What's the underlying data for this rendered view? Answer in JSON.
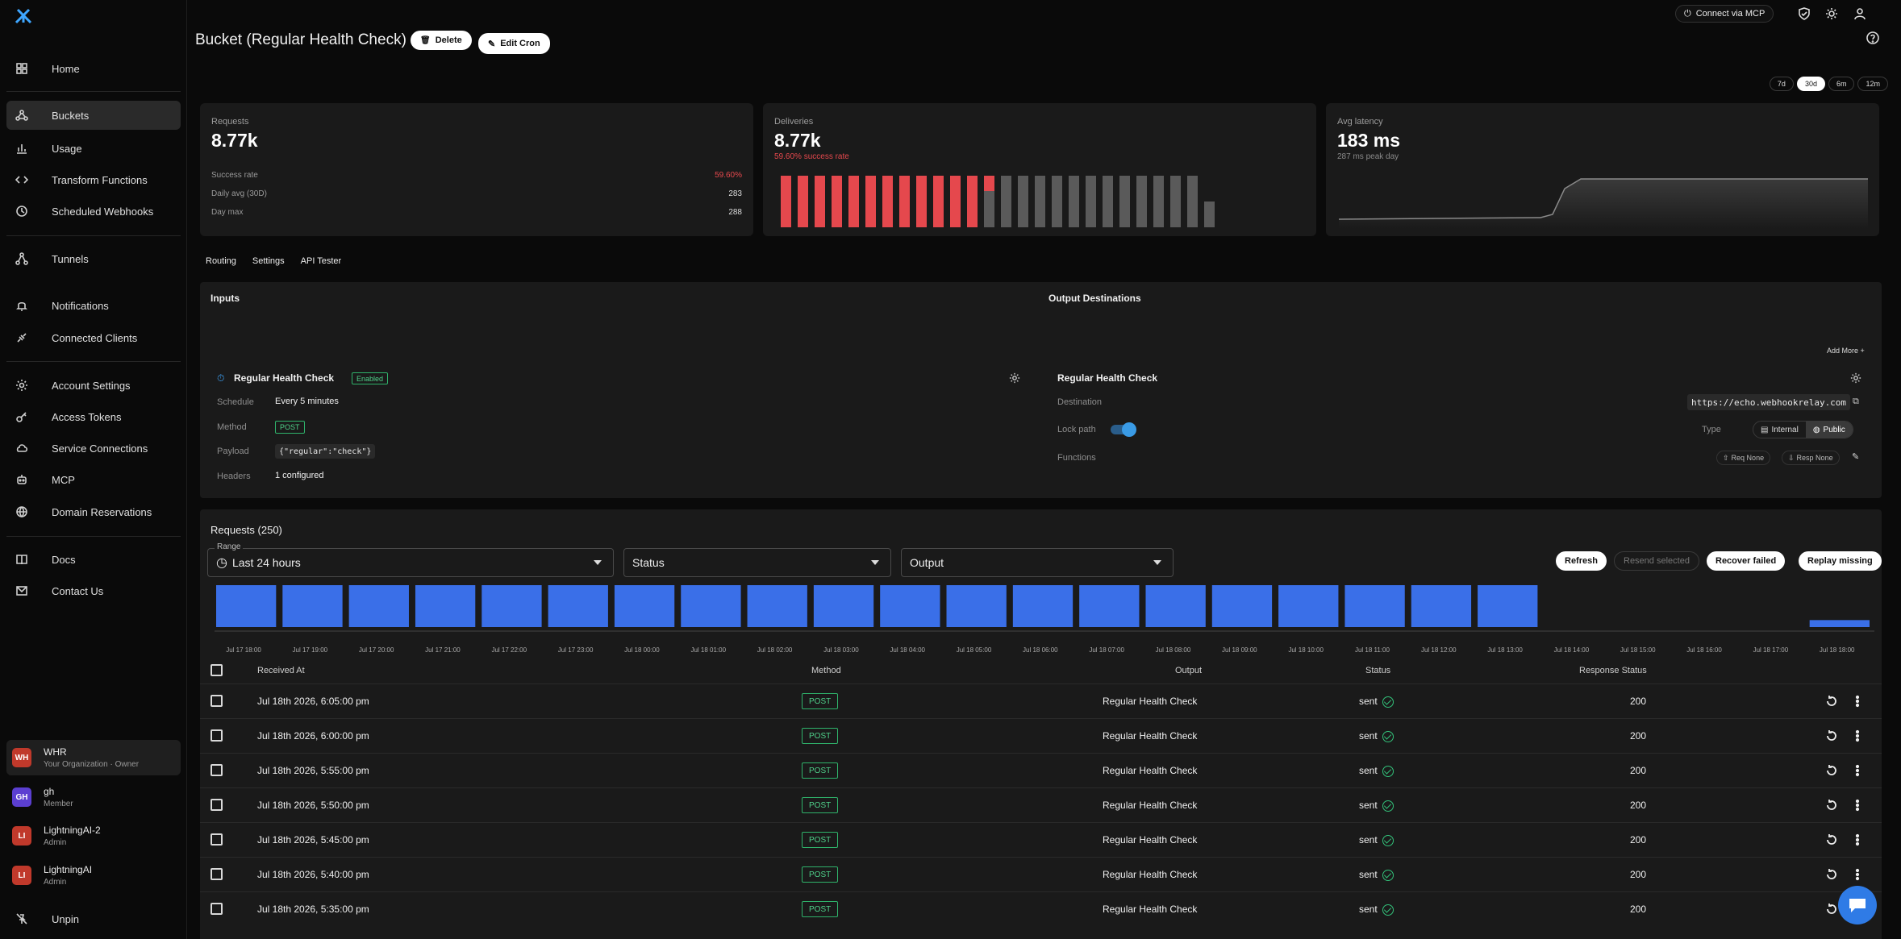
{
  "nav": {
    "items": [
      {
        "label": "Home",
        "icon": "grid-icon"
      },
      {
        "label": "Buckets",
        "icon": "webhook-icon"
      },
      {
        "label": "Usage",
        "icon": "bar-chart-icon"
      },
      {
        "label": "Transform Functions",
        "icon": "code-icon"
      },
      {
        "label": "Scheduled Webhooks",
        "icon": "clock-icon"
      },
      {
        "label": "Tunnels",
        "icon": "tunnel-icon"
      },
      {
        "label": "Notifications",
        "icon": "bell-icon"
      },
      {
        "label": "Connected Clients",
        "icon": "plug-icon"
      },
      {
        "label": "Account Settings",
        "icon": "gear-icon"
      },
      {
        "label": "Access Tokens",
        "icon": "key-icon"
      },
      {
        "label": "Service Connections",
        "icon": "cloud-icon"
      },
      {
        "label": "MCP",
        "icon": "robot-icon"
      },
      {
        "label": "Domain Reservations",
        "icon": "globe-icon"
      },
      {
        "label": "Docs",
        "icon": "book-icon"
      },
      {
        "label": "Contact Us",
        "icon": "mail-icon"
      }
    ],
    "active": "Buckets",
    "orgs": [
      {
        "initials": "WH",
        "name": "WHR",
        "role": "Your Organization · Owner",
        "color": "#c0392b"
      },
      {
        "initials": "GH",
        "name": "gh",
        "role": "Member",
        "color": "#5b3fd1"
      },
      {
        "initials": "LI",
        "name": "LightningAI-2",
        "role": "Admin",
        "color": "#c0392b"
      },
      {
        "initials": "LI",
        "name": "LightningAI",
        "role": "Admin",
        "color": "#c0392b"
      }
    ],
    "unpin": "Unpin"
  },
  "topbar": {
    "connect_mcp": "Connect via MCP"
  },
  "header": {
    "title": "Bucket (Regular Health Check)",
    "delete": "Delete",
    "edit_cron": "Edit Cron"
  },
  "ranges": [
    "7d",
    "30d",
    "6m",
    "12m"
  ],
  "selected_range": "30d",
  "cards": {
    "requests": {
      "label": "Requests",
      "value": "8.77k",
      "success_label": "Success rate",
      "success_value": "59.60%",
      "daily_label": "Daily avg (30D)",
      "daily_value": "283",
      "max_label": "Day max",
      "max_value": "288"
    },
    "deliveries": {
      "label": "Deliveries",
      "value": "8.77k",
      "sub": "59.60% success rate",
      "bars": {
        "red_full": 12,
        "split": 1,
        "grey": 13
      }
    },
    "latency": {
      "label": "Avg latency",
      "value": "183 ms",
      "sub": "287 ms peak day"
    }
  },
  "tabs": [
    "Routing",
    "Settings",
    "API Tester"
  ],
  "inputs": {
    "heading": "Inputs",
    "name": "Regular Health Check",
    "status": "Enabled",
    "schedule_label": "Schedule",
    "schedule_value": "Every 5 minutes",
    "method_label": "Method",
    "method_value": "POST",
    "payload_label": "Payload",
    "payload_value": "{\"regular\":\"check\"}",
    "headers_label": "Headers",
    "headers_value": "1 configured"
  },
  "outputs": {
    "heading": "Output Destinations",
    "add_more": "Add More +",
    "name": "Regular Health Check",
    "destination_label": "Destination",
    "destination_value": "https://echo.webhookrelay.com",
    "lock_label": "Lock path",
    "lock_on": true,
    "type_label": "Type",
    "type_internal": "Internal",
    "type_public": "Public",
    "type_selected": "Public",
    "functions_label": "Functions",
    "req_fn": "Req None",
    "resp_fn": "Resp None"
  },
  "requests": {
    "title": "Requests (250)",
    "range_legend": "Range",
    "range_value": "Last 24 hours",
    "status_placeholder": "Status",
    "output_placeholder": "Output",
    "refresh": "Refresh",
    "resend": "Resend selected",
    "recover": "Recover failed",
    "replay": "Replay missing",
    "columns": {
      "received": "Received At",
      "method": "Method",
      "output": "Output",
      "status": "Status",
      "response": "Response Status"
    },
    "rows": [
      {
        "received": "Jul 18th 2026, 6:05:00 pm",
        "method": "POST",
        "output": "Regular Health Check",
        "status": "sent",
        "response": "200"
      },
      {
        "received": "Jul 18th 2026, 6:00:00 pm",
        "method": "POST",
        "output": "Regular Health Check",
        "status": "sent",
        "response": "200"
      },
      {
        "received": "Jul 18th 2026, 5:55:00 pm",
        "method": "POST",
        "output": "Regular Health Check",
        "status": "sent",
        "response": "200"
      },
      {
        "received": "Jul 18th 2026, 5:50:00 pm",
        "method": "POST",
        "output": "Regular Health Check",
        "status": "sent",
        "response": "200"
      },
      {
        "received": "Jul 18th 2026, 5:45:00 pm",
        "method": "POST",
        "output": "Regular Health Check",
        "status": "sent",
        "response": "200"
      },
      {
        "received": "Jul 18th 2026, 5:40:00 pm",
        "method": "POST",
        "output": "Regular Health Check",
        "status": "sent",
        "response": "200"
      },
      {
        "received": "Jul 18th 2026, 5:35:00 pm",
        "method": "POST",
        "output": "Regular Health Check",
        "status": "sent",
        "response": "200"
      }
    ]
  },
  "chart_data": {
    "type": "bar",
    "categories": [
      "Jul 17 18:00",
      "Jul 17 19:00",
      "Jul 17 20:00",
      "Jul 17 21:00",
      "Jul 17 22:00",
      "Jul 17 23:00",
      "Jul 18 00:00",
      "Jul 18 01:00",
      "Jul 18 02:00",
      "Jul 18 03:00",
      "Jul 18 04:00",
      "Jul 18 05:00",
      "Jul 18 06:00",
      "Jul 18 07:00",
      "Jul 18 08:00",
      "Jul 18 09:00",
      "Jul 18 10:00",
      "Jul 18 11:00",
      "Jul 18 12:00",
      "Jul 18 13:00",
      "Jul 18 14:00",
      "Jul 18 15:00",
      "Jul 18 16:00",
      "Jul 18 17:00",
      "Jul 18 18:00"
    ],
    "values": [
      12,
      12,
      12,
      12,
      12,
      12,
      12,
      12,
      12,
      12,
      12,
      12,
      12,
      12,
      12,
      12,
      12,
      12,
      12,
      12,
      0,
      0,
      0,
      0,
      2
    ],
    "color": "#3a6fe8"
  },
  "colors": {
    "accent": "#3a6fe8",
    "danger": "#e5484d",
    "success": "#2fb36b"
  }
}
